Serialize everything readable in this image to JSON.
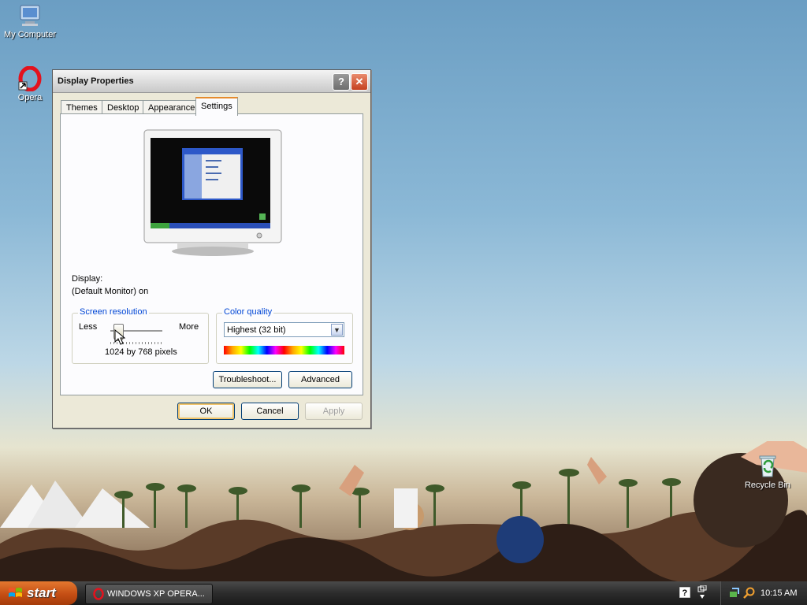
{
  "desktop": {
    "icons": [
      {
        "label": "My Computer",
        "icon": "my-computer-icon"
      },
      {
        "label": "Opera",
        "icon": "opera-icon"
      },
      {
        "label": "Recycle Bin",
        "icon": "recycle-bin-icon"
      }
    ]
  },
  "window": {
    "title": "Display Properties",
    "tabs": [
      {
        "label": "Themes"
      },
      {
        "label": "Desktop"
      },
      {
        "label": "Appearance"
      },
      {
        "label": "Settings",
        "active": true
      }
    ],
    "display_label": "Display:",
    "display_value": "(Default Monitor) on",
    "screen_resolution": {
      "legend": "Screen resolution",
      "less": "Less",
      "more": "More",
      "value_text": "1024 by 768 pixels",
      "slider_fraction": 0.15
    },
    "color_quality": {
      "legend": "Color quality",
      "selected": "Highest (32 bit)"
    },
    "buttons": {
      "troubleshoot": "Troubleshoot...",
      "advanced": "Advanced",
      "ok": "OK",
      "cancel": "Cancel",
      "apply": "Apply"
    }
  },
  "taskbar": {
    "start_label": "start",
    "task_label": "WINDOWS XP OPERA...",
    "clock": "10:15 AM"
  },
  "colors": {
    "accent_tab": "#e68b2c",
    "legend_text": "#0046d5",
    "start_button": "#c44e14"
  }
}
